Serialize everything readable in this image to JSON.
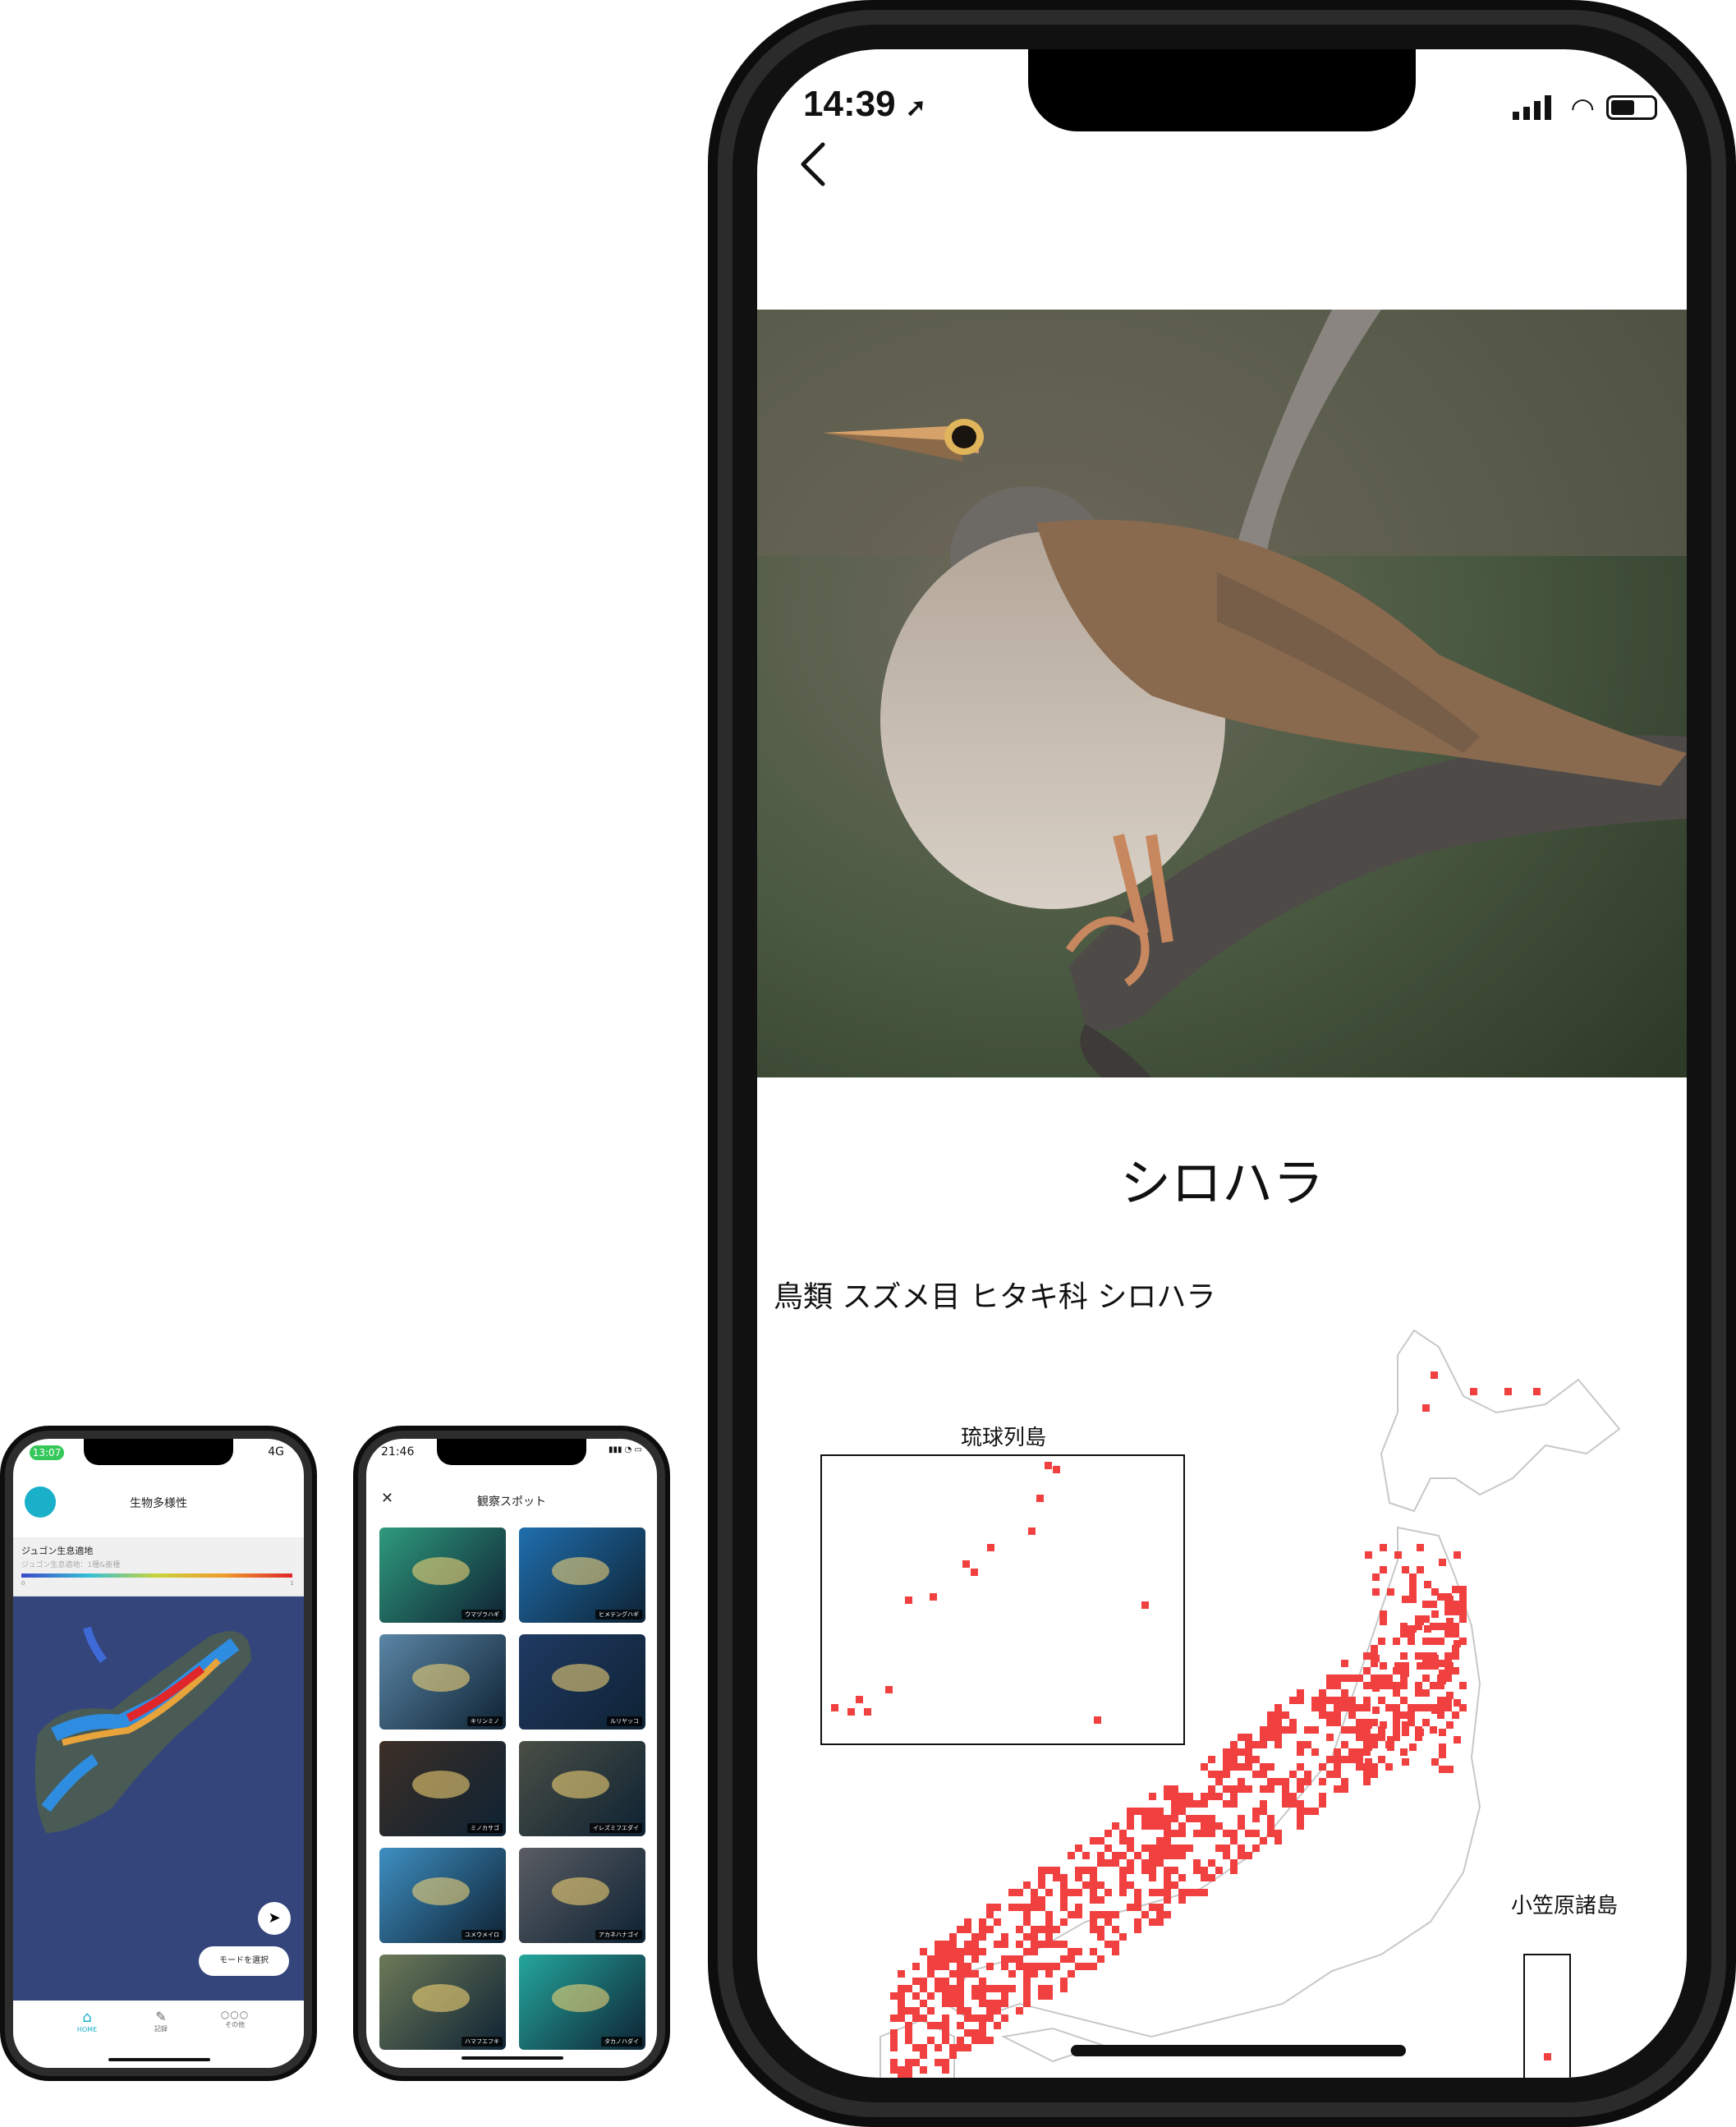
{
  "phone1": {
    "status_time": "13:07",
    "network": "4G",
    "title": "生物多様性",
    "layer_title": "ジュゴン生息適地",
    "layer_subtitle": "ジュゴン生息適地：1種&亜種",
    "legend_min": "0",
    "legend_max": "1",
    "mode_button": "モードを選択",
    "tabs": [
      {
        "label": "HOME",
        "icon": "home-icon",
        "active": true
      },
      {
        "label": "記録",
        "icon": "pencil-icon",
        "active": false
      },
      {
        "label": "その他",
        "icon": "more-icon",
        "active": false
      }
    ],
    "accent": "#1ab0c9"
  },
  "phone2": {
    "status_time": "21:46",
    "title": "観察スポット",
    "close_icon": "close-icon",
    "spots": [
      {
        "label": "ウマヅラハギ",
        "bg": "#2f9a7d"
      },
      {
        "label": "ヒメテングハギ",
        "bg": "#1f6fae"
      },
      {
        "label": "キリンミノ",
        "bg": "#5b86a6"
      },
      {
        "label": "ルリヤッコ",
        "bg": "#203a63"
      },
      {
        "label": "ミノカサゴ",
        "bg": "#3c2f26"
      },
      {
        "label": "イレズミフエダイ",
        "bg": "#4a4f45"
      },
      {
        "label": "ユメウメイロ",
        "bg": "#3e8fc2"
      },
      {
        "label": "アカネハナゴイ",
        "bg": "#5a5d63"
      },
      {
        "label": "ハマフエフキ",
        "bg": "#6d7a58"
      },
      {
        "label": "タカノハダイ",
        "bg": "#24a79d"
      }
    ]
  },
  "phone3": {
    "status_time": "14:39",
    "species_name": "シロハラ",
    "taxonomy": "鳥類 スズメ目 ヒタキ科 シロハラ",
    "inset_ryukyu": "琉球列島",
    "inset_ogasawara": "小笠原諸島",
    "distribution_color": "#f04040"
  }
}
